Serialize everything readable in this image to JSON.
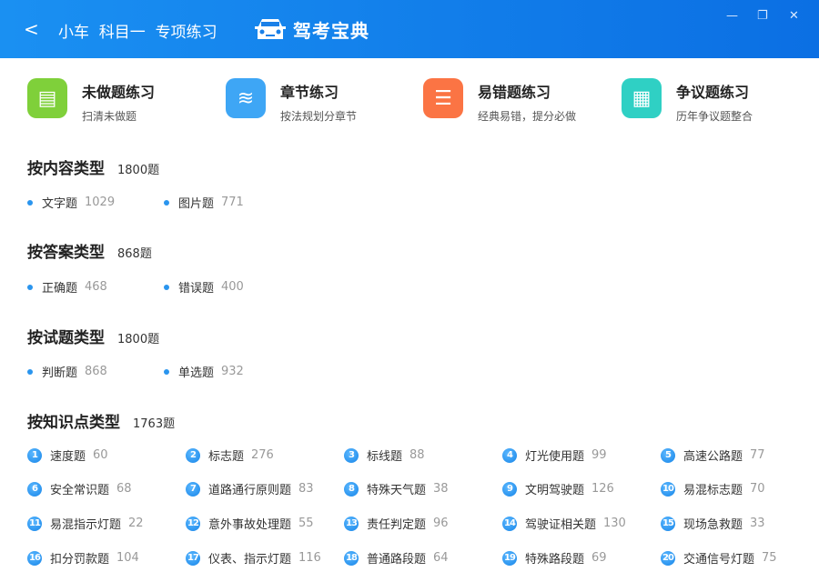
{
  "header": {
    "back_label": "<",
    "title": "小车  科目一  专项练习",
    "logo_text": "驾考宝典"
  },
  "window": {
    "minimize": "—",
    "restore": "❐",
    "close": "✕"
  },
  "cards": [
    {
      "title": "未做题练习",
      "subtitle": "扫清未做题",
      "color": "#7fd03a"
    },
    {
      "title": "章节练习",
      "subtitle": "按法规划分章节",
      "color": "#3ea6f5"
    },
    {
      "title": "易错题练习",
      "subtitle": "经典易错，提分必做",
      "color": "#fb7444"
    },
    {
      "title": "争议题练习",
      "subtitle": "历年争议题整合",
      "color": "#2fd0c4"
    }
  ],
  "sections": [
    {
      "title": "按内容类型",
      "count": "1800题",
      "items": [
        {
          "label": "文字题",
          "count": "1029"
        },
        {
          "label": "图片题",
          "count": "771"
        }
      ]
    },
    {
      "title": "按答案类型",
      "count": "868题",
      "items": [
        {
          "label": "正确题",
          "count": "468"
        },
        {
          "label": "错误题",
          "count": "400"
        }
      ]
    },
    {
      "title": "按试题类型",
      "count": "1800题",
      "items": [
        {
          "label": "判断题",
          "count": "868"
        },
        {
          "label": "单选题",
          "count": "932"
        }
      ]
    }
  ],
  "knowledge": {
    "title": "按知识点类型",
    "count": "1763题",
    "items": [
      {
        "n": "1",
        "label": "速度题",
        "count": "60"
      },
      {
        "n": "2",
        "label": "标志题",
        "count": "276"
      },
      {
        "n": "3",
        "label": "标线题",
        "count": "88"
      },
      {
        "n": "4",
        "label": "灯光使用题",
        "count": "99"
      },
      {
        "n": "5",
        "label": "高速公路题",
        "count": "77"
      },
      {
        "n": "6",
        "label": "安全常识题",
        "count": "68"
      },
      {
        "n": "7",
        "label": "道路通行原则题",
        "count": "83"
      },
      {
        "n": "8",
        "label": "特殊天气题",
        "count": "38"
      },
      {
        "n": "9",
        "label": "文明驾驶题",
        "count": "126"
      },
      {
        "n": "10",
        "label": "易混标志题",
        "count": "70"
      },
      {
        "n": "11",
        "label": "易混指示灯题",
        "count": "22"
      },
      {
        "n": "12",
        "label": "意外事故处理题",
        "count": "55"
      },
      {
        "n": "13",
        "label": "责任判定题",
        "count": "96"
      },
      {
        "n": "14",
        "label": "驾驶证相关题",
        "count": "130"
      },
      {
        "n": "15",
        "label": "现场急救题",
        "count": "33"
      },
      {
        "n": "16",
        "label": "扣分罚款题",
        "count": "104"
      },
      {
        "n": "17",
        "label": "仪表、指示灯题",
        "count": "116"
      },
      {
        "n": "18",
        "label": "普通路段题",
        "count": "64"
      },
      {
        "n": "19",
        "label": "特殊路段题",
        "count": "69"
      },
      {
        "n": "20",
        "label": "交通信号灯题",
        "count": "75"
      }
    ]
  }
}
